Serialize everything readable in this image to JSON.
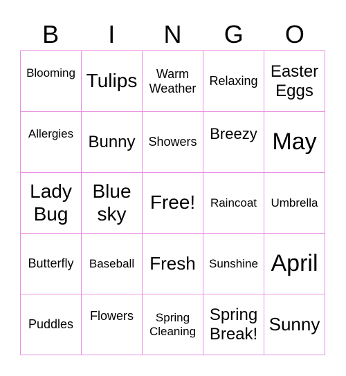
{
  "header": {
    "letters": [
      "B",
      "I",
      "N",
      "G",
      "O"
    ]
  },
  "colors": {
    "grid_line": "#ea8ee4",
    "text": "#000000",
    "background": "#ffffff"
  },
  "cells": [
    [
      "Blooming",
      "Tulips",
      "Warm Weather",
      "Relaxing",
      "Easter Eggs"
    ],
    [
      "Allergies",
      "Bunny",
      "Showers",
      "Breezy",
      "May"
    ],
    [
      "Lady Bug",
      "Blue sky",
      "Free!",
      "Raincoat",
      "Umbrella"
    ],
    [
      "Butterfly",
      "Baseball",
      "Fresh",
      "Sunshine",
      "April"
    ],
    [
      "Puddles",
      "Flowers",
      "Spring Cleaning",
      "Spring Break!",
      "Sunny"
    ]
  ]
}
